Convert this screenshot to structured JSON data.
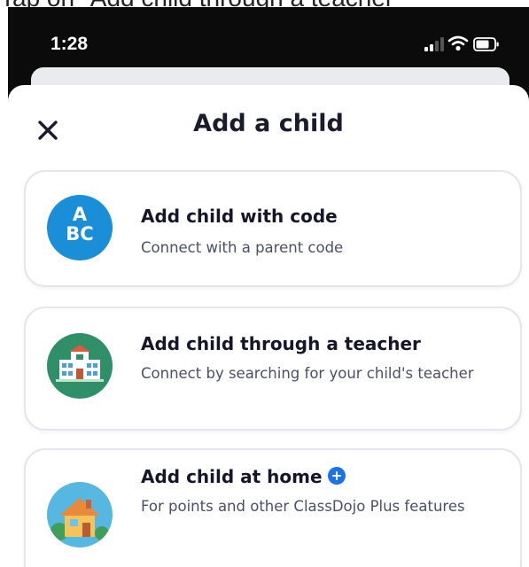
{
  "caption": "Tap on \"Add child through a teacher\"",
  "status_bar": {
    "time": "1:28",
    "icons": [
      "cellular-signal-icon",
      "wifi-icon",
      "battery-icon"
    ]
  },
  "sheet": {
    "title": "Add a child",
    "close_icon": "close-icon"
  },
  "options": [
    {
      "icon": "abc-icon",
      "icon_text_top": "A",
      "icon_text_bottom": "BC",
      "title": "Add child with code",
      "description": "Connect with a parent code"
    },
    {
      "icon": "school-building-icon",
      "title": "Add child through a teacher",
      "description": "Connect by searching for your child's teacher"
    },
    {
      "icon": "house-icon",
      "title": "Add child at home",
      "badge_icon": "plus-badge-icon",
      "description": "For points and other ClassDojo Plus features"
    }
  ],
  "colors": {
    "background": "#0b0b0b",
    "sheet": "#ffffff",
    "card_border": "#e3e6ee",
    "abc_icon_bg": "#1a8fd8",
    "school_icon_bg": "#2e8f69",
    "house_icon_bg": "#56b7e0",
    "plus_badge": "#1a73e8"
  }
}
